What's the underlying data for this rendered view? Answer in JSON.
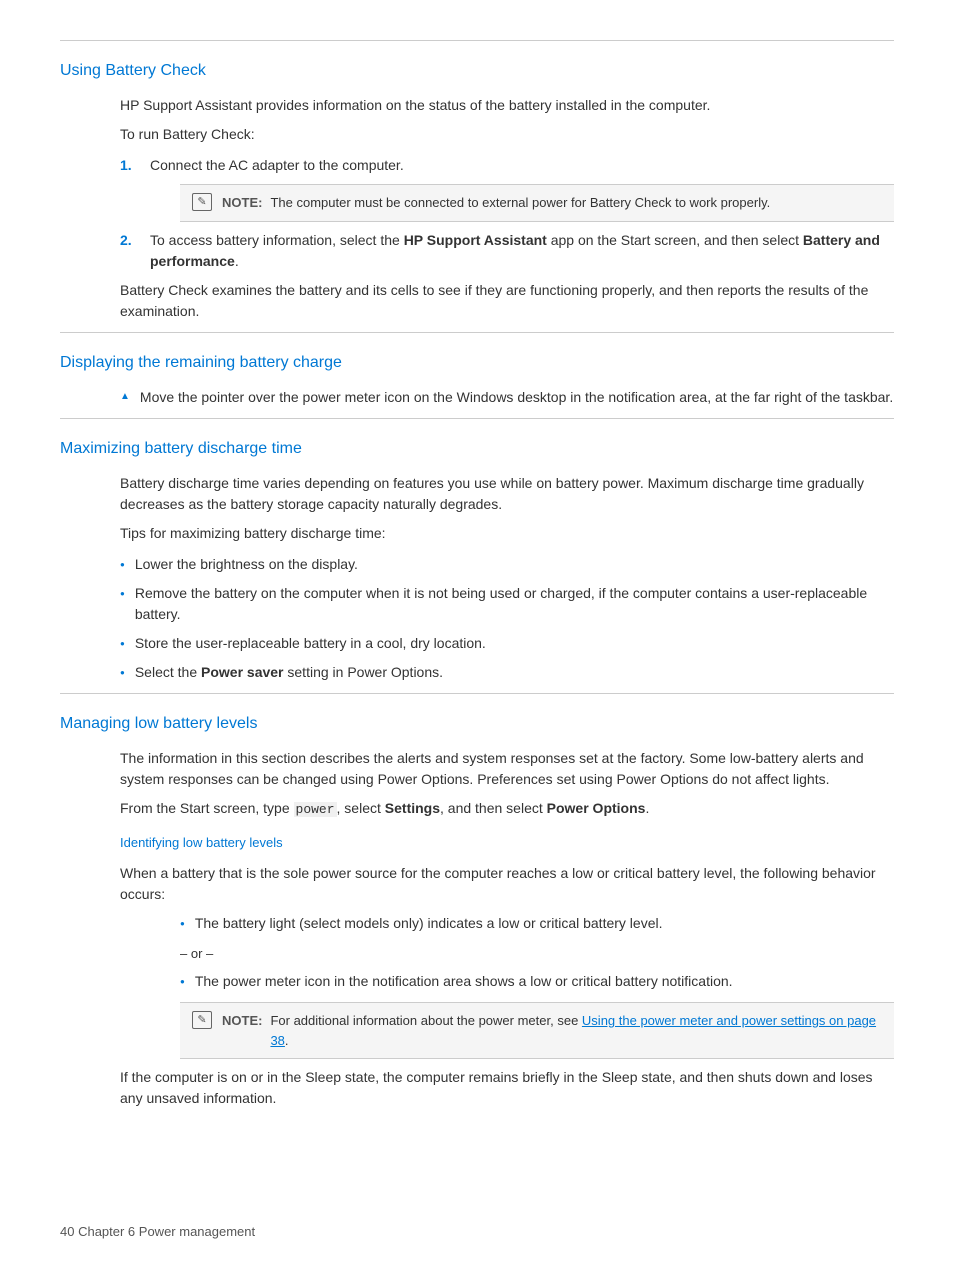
{
  "page": {
    "footer": "40    Chapter 6   Power management"
  },
  "sections": [
    {
      "id": "using-battery-check",
      "title": "Using Battery Check",
      "content": [
        {
          "type": "paragraph",
          "text": "HP Support Assistant provides information on the status of the battery installed in the computer."
        },
        {
          "type": "paragraph",
          "text": "To run Battery Check:"
        },
        {
          "type": "numbered",
          "items": [
            {
              "num": "1.",
              "text": "Connect the AC adapter to the computer."
            },
            {
              "type": "note",
              "icon": "note-icon",
              "label": "NOTE:",
              "text": "The computer must be connected to external power for Battery Check to work properly."
            },
            {
              "num": "2.",
              "text": "To access battery information, select the HP Support Assistant app on the Start screen, and then select Battery and performance.",
              "bold_parts": [
                "HP Support Assistant",
                "Battery and performance"
              ]
            }
          ]
        },
        {
          "type": "paragraph",
          "text": "Battery Check examines the battery and its cells to see if they are functioning properly, and then reports the results of the examination."
        }
      ]
    },
    {
      "id": "displaying-remaining",
      "title": "Displaying the remaining battery charge",
      "content": [
        {
          "type": "triangle-list",
          "items": [
            "Move the pointer over the power meter icon on the Windows desktop in the notification area, at the far right of the taskbar."
          ]
        }
      ]
    },
    {
      "id": "maximizing-battery",
      "title": "Maximizing battery discharge time",
      "content": [
        {
          "type": "paragraph",
          "text": "Battery discharge time varies depending on features you use while on battery power. Maximum discharge time gradually decreases as the battery storage capacity naturally degrades."
        },
        {
          "type": "paragraph",
          "text": "Tips for maximizing battery discharge time:"
        },
        {
          "type": "bullet-list",
          "items": [
            "Lower the brightness on the display.",
            "Remove the battery on the computer when it is not being used or charged, if the computer contains a user-replaceable battery.",
            "Store the user-replaceable battery in a cool, dry location.",
            "Select the Power saver setting in Power Options."
          ],
          "bold_parts_per_item": [
            null,
            null,
            null,
            [
              "Power saver"
            ]
          ]
        }
      ]
    },
    {
      "id": "managing-low-battery",
      "title": "Managing low battery levels",
      "content": [
        {
          "type": "paragraph",
          "text": "The information in this section describes the alerts and system responses set at the factory. Some low-battery alerts and system responses can be changed using Power Options. Preferences set using Power Options do not affect lights."
        },
        {
          "type": "paragraph",
          "text": "From the Start screen, type power, select Settings, and then select Power Options.",
          "has_code": true,
          "code_word": "power",
          "bold_words": [
            "Settings",
            "Power Options"
          ]
        },
        {
          "type": "subsection",
          "title": "Identifying low battery levels",
          "content": [
            {
              "type": "paragraph",
              "text": "When a battery that is the sole power source for the computer reaches a low or critical battery level, the following behavior occurs:"
            },
            {
              "type": "bullet-list",
              "items": [
                "The battery light (select models only) indicates a low or critical battery level."
              ]
            },
            {
              "type": "or-line",
              "text": "– or –"
            },
            {
              "type": "bullet-list",
              "items": [
                "The power meter icon in the notification area shows a low or critical battery notification."
              ]
            },
            {
              "type": "note",
              "label": "NOTE:",
              "text": "For additional information about the power meter, see Using the power meter and power settings on page 38.",
              "link_text": "Using the power meter and power settings on page 38"
            },
            {
              "type": "paragraph",
              "text": "If the computer is on or in the Sleep state, the computer remains briefly in the Sleep state, and then shuts down and loses any unsaved information."
            }
          ]
        }
      ]
    }
  ]
}
